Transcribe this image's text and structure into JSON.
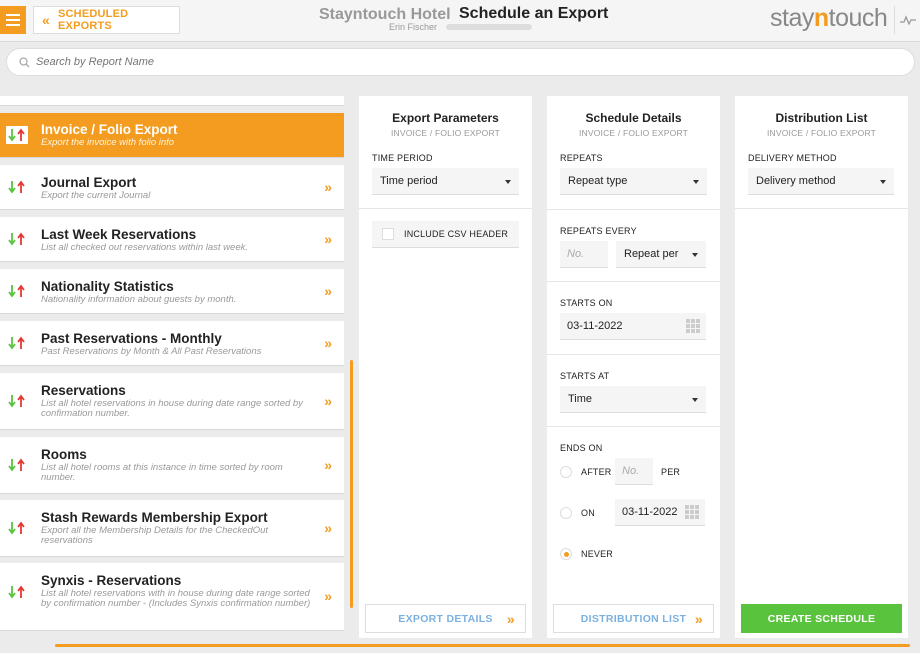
{
  "header": {
    "back_label": "SCHEDULED EXPORTS",
    "hotel_name": "Stayntouch Hotel",
    "user_name": "Erin Fischer",
    "page_title": "Schedule an Export",
    "logo_part1": "stay",
    "logo_part2": "n",
    "logo_part3": "touch"
  },
  "search": {
    "placeholder": "Search by Report Name"
  },
  "reports": [
    {
      "title": "Invoice / Folio Export",
      "desc": "Export the invoice with folio info"
    },
    {
      "title": "Journal Export",
      "desc": "Export the current Journal"
    },
    {
      "title": "Last Week Reservations",
      "desc": "List all checked out reservations within last week."
    },
    {
      "title": "Nationality Statistics",
      "desc": "Nationality information about guests by month."
    },
    {
      "title": "Past Reservations - Monthly",
      "desc": "Past Reservations by Month & All Past Reservations"
    },
    {
      "title": "Reservations",
      "desc": "List all hotel reservations in house during date range sorted by confirmation number."
    },
    {
      "title": "Rooms",
      "desc": "List all hotel rooms at this instance in time sorted by room number."
    },
    {
      "title": "Stash Rewards Membership Export",
      "desc": "Export all the Membership Details for the CheckedOut reservations"
    },
    {
      "title": "Synxis - Reservations",
      "desc": "List all hotel reservations with in house during date range sorted by confirmation number - (Includes Synxis confirmation number)"
    }
  ],
  "params": {
    "title": "Export Parameters",
    "subtitle": "INVOICE / FOLIO EXPORT",
    "time_period_label": "TIME PERIOD",
    "time_period_value": "Time period",
    "csv_label": "INCLUDE CSV HEADER",
    "footer_label": "EXPORT DETAILS"
  },
  "schedule": {
    "title": "Schedule Details",
    "subtitle": "INVOICE / FOLIO EXPORT",
    "repeats_label": "REPEATS",
    "repeats_value": "Repeat type",
    "repeats_every_label": "REPEATS EVERY",
    "repeats_every_placeholder": "No.",
    "repeat_per_value": "Repeat per",
    "starts_on_label": "STARTS ON",
    "starts_on_value": "03-11-2022",
    "starts_at_label": "STARTS AT",
    "starts_at_value": "Time",
    "ends_on_label": "ENDS ON",
    "after_label": "AFTER",
    "after_placeholder": "No.",
    "per_label": "PER",
    "on_label": "ON",
    "on_date_value": "03-11-2022",
    "never_label": "NEVER",
    "footer_label": "DISTRIBUTION LIST"
  },
  "distribution": {
    "title": "Distribution List",
    "subtitle": "INVOICE / FOLIO EXPORT",
    "delivery_label": "DELIVERY METHOD",
    "delivery_value": "Delivery method",
    "footer_label": "CREATE SCHEDULE"
  },
  "colors": {
    "accent": "#f39c1f",
    "green": "#5ac33e",
    "link_blue": "#7bb1e0"
  }
}
